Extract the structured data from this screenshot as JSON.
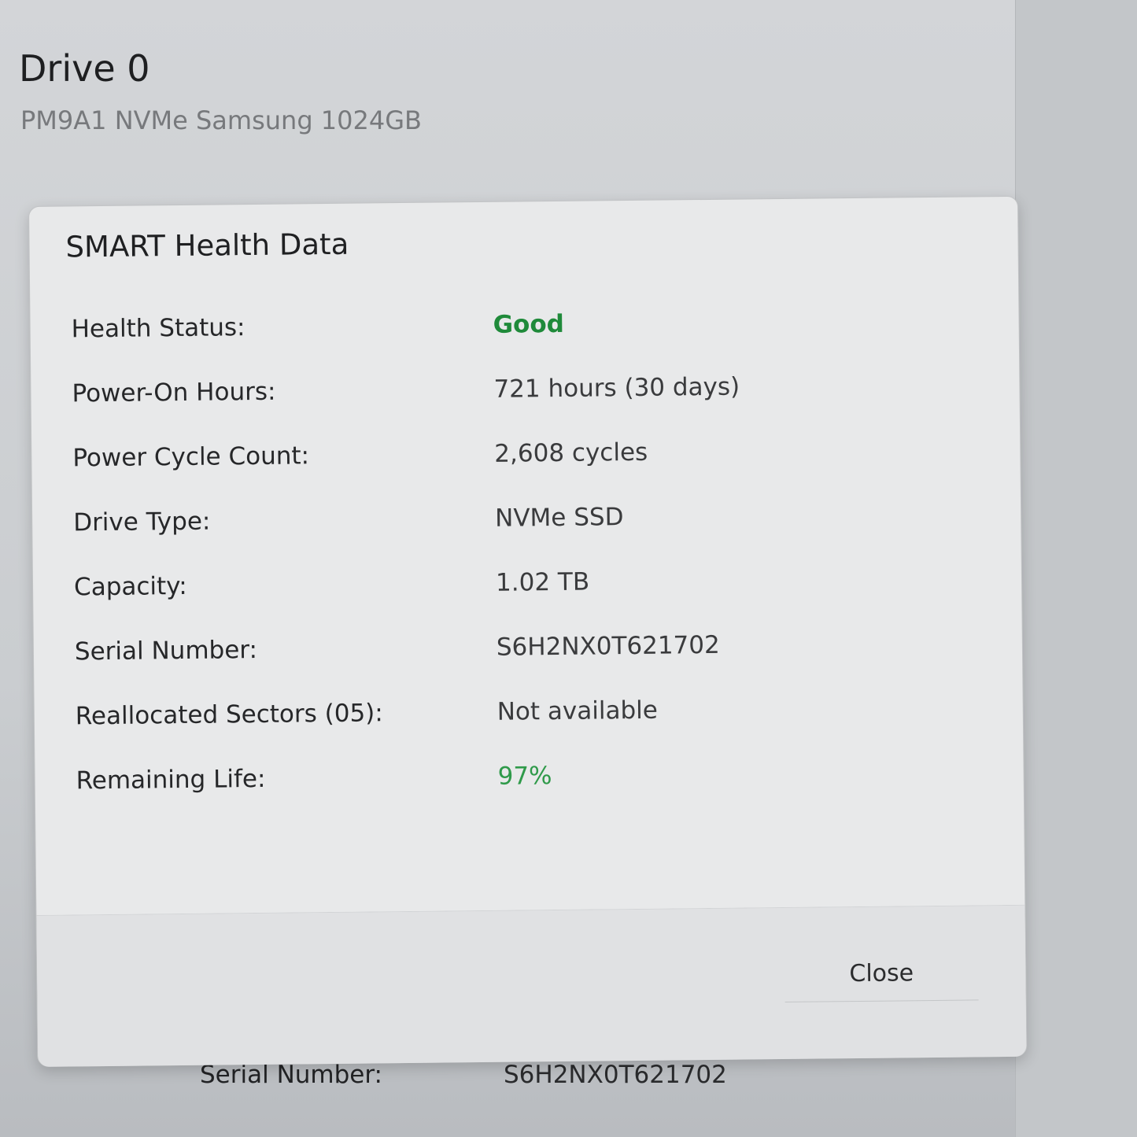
{
  "drive": {
    "title": "Drive 0",
    "model": "PM9A1 NVMe Samsung 1024GB"
  },
  "dialog": {
    "title": "SMART Health Data",
    "rows": [
      {
        "label": "Health Status:",
        "value": "Good"
      },
      {
        "label": "Power-On Hours:",
        "value": "721 hours (30 days)"
      },
      {
        "label": "Power Cycle Count:",
        "value": "2,608 cycles"
      },
      {
        "label": "Drive Type:",
        "value": "NVMe SSD"
      },
      {
        "label": "Capacity:",
        "value": "1.02 TB"
      },
      {
        "label": "Serial Number:",
        "value": "S6H2NX0T621702"
      },
      {
        "label": "Reallocated Sectors (05):",
        "value": "Not available"
      },
      {
        "label": "Remaining Life:",
        "value": "97%"
      }
    ],
    "close_label": "Close"
  },
  "background_details": {
    "label": "Serial Number:",
    "value": "S6H2NX0T621702"
  },
  "colors": {
    "status_good": "#1f8a3a",
    "life_value": "#2f9a4a"
  }
}
